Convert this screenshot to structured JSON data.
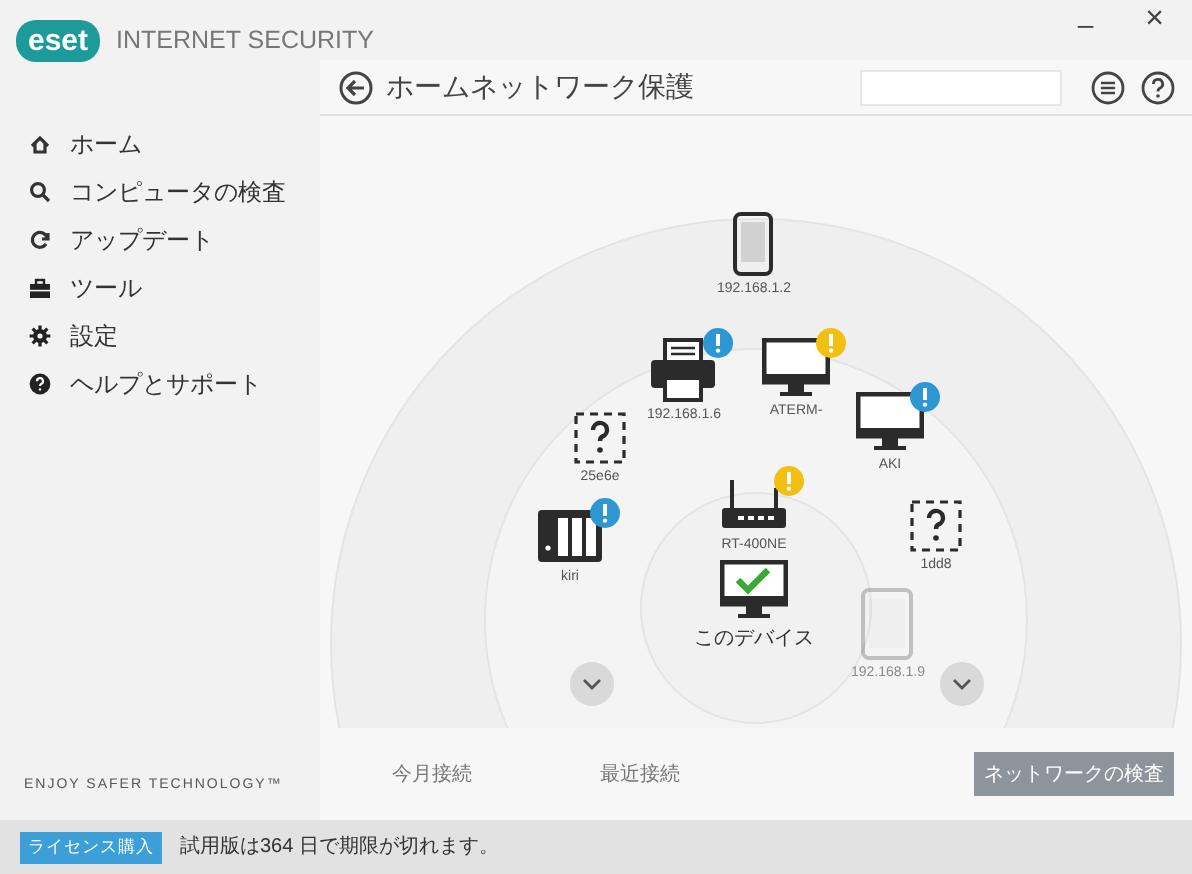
{
  "app": {
    "logo": "eset",
    "product": "INTERNET SECURITY"
  },
  "window_controls": {
    "minimize": "–",
    "close": "×"
  },
  "sidebar": {
    "items": [
      {
        "kind": "home",
        "label": "ホーム"
      },
      {
        "kind": "scan",
        "label": "コンピュータの検査"
      },
      {
        "kind": "update",
        "label": "アップデート"
      },
      {
        "kind": "tools",
        "label": "ツール"
      },
      {
        "kind": "settings",
        "label": "設定"
      },
      {
        "kind": "help",
        "label": "ヘルプとサポート"
      }
    ],
    "slogan": "ENJOY SAFER TECHNOLOGY™"
  },
  "page": {
    "title": "ホームネットワーク保護"
  },
  "devices": [
    {
      "kind": "phone",
      "label": "192.168.1.2",
      "faded": false
    },
    {
      "kind": "printer",
      "label": "192.168.1.6",
      "badge": {
        "color": "#2d96d3"
      },
      "faded": false
    },
    {
      "kind": "monitor",
      "label": "ATERM-",
      "badge": {
        "color": "#f2c012"
      },
      "faded": false
    },
    {
      "kind": "monitor",
      "label": "AKI",
      "badge": {
        "color": "#2d96d3"
      },
      "faded": false
    },
    {
      "kind": "unknown",
      "label": "25e6e",
      "faded": false
    },
    {
      "kind": "nas",
      "label": "kiri",
      "badge": {
        "color": "#2d96d3"
      },
      "faded": false
    },
    {
      "kind": "router",
      "label": "RT-400NE",
      "badge": {
        "color": "#f2c012"
      },
      "faded": false
    },
    {
      "kind": "this",
      "label": "このデバイス",
      "faded": false
    },
    {
      "kind": "unknown",
      "label": "1dd8",
      "faded": false
    },
    {
      "kind": "tablet",
      "label": "192.168.1.9",
      "faded": true
    }
  ],
  "tabs": [
    {
      "label": "今月接続"
    },
    {
      "label": "最近接続"
    }
  ],
  "scan_button": "ネットワークの検査",
  "status_bar": {
    "button": "ライセンス購入",
    "message": "試用版は364 日で期限が切れます。"
  }
}
